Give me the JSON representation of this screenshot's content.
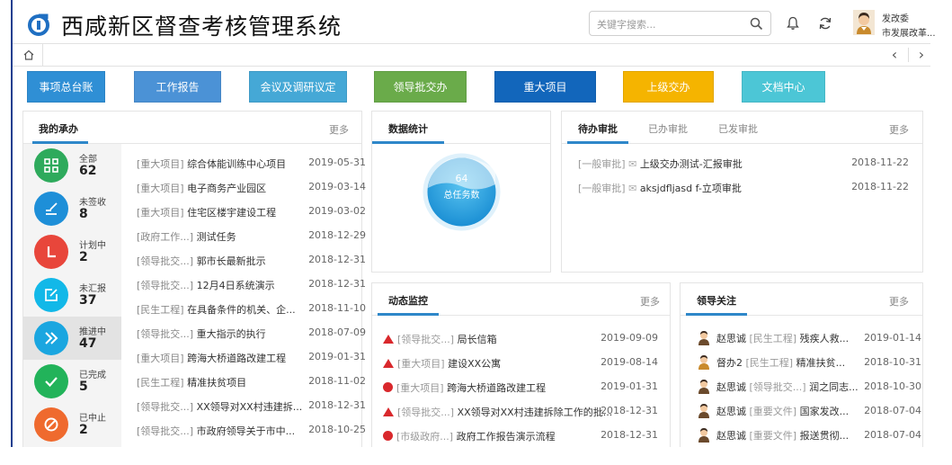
{
  "app": {
    "title": "西咸新区督查考核管理系统"
  },
  "header": {
    "search_placeholder": "关键字搜索...",
    "user": {
      "name": "发改委",
      "dept": "市发展改革..."
    }
  },
  "modules": [
    {
      "label": "事项总台账",
      "color": "#2f8fd5"
    },
    {
      "label": "工作报告",
      "color": "#4b92d6"
    },
    {
      "label": "会议及调研议定",
      "color": "#45a8d6"
    },
    {
      "label": "领导批交办",
      "color": "#6aab4a"
    },
    {
      "label": "重大项目",
      "color": "#1266bb"
    },
    {
      "label": "上级交办",
      "color": "#f5b400"
    },
    {
      "label": "文档中心",
      "color": "#4cc6d6"
    }
  ],
  "my_tasks": {
    "title": "我的承办",
    "more": "更多",
    "stats": [
      {
        "label": "全部",
        "count": "62",
        "color": "#2eaa5c",
        "icon": "grid-icon"
      },
      {
        "label": "未签收",
        "count": "8",
        "color": "#1e8fd8",
        "icon": "sign-icon"
      },
      {
        "label": "计划中",
        "count": "2",
        "color": "#e8463b",
        "icon": "clock-icon"
      },
      {
        "label": "未汇报",
        "count": "37",
        "color": "#12b8e8",
        "icon": "edit-icon"
      },
      {
        "label": "推进中",
        "count": "47",
        "color": "#1aa6e0",
        "icon": "forward-icon"
      },
      {
        "label": "已完成",
        "count": "5",
        "color": "#22b35a",
        "icon": "check-icon"
      },
      {
        "label": "已中止",
        "count": "2",
        "color": "#ef6a2e",
        "icon": "stop-icon"
      }
    ],
    "rows": [
      {
        "cat": "[重大项目]",
        "title": "综合体能训练中心项目",
        "date": "2019-05-31"
      },
      {
        "cat": "[重大项目]",
        "title": "电子商务产业园区",
        "date": "2019-03-14"
      },
      {
        "cat": "[重大项目]",
        "title": "住宅区楼宇建设工程",
        "date": "2019-03-02"
      },
      {
        "cat": "[政府工作...]",
        "title": "测试任务",
        "date": "2018-12-29"
      },
      {
        "cat": "[领导批交...]",
        "title": "郭市长最新批示",
        "date": "2018-12-31"
      },
      {
        "cat": "[领导批交...]",
        "title": "12月4日系统演示",
        "date": "2018-12-31"
      },
      {
        "cat": "[民生工程]",
        "title": "在具备条件的机关、企...",
        "date": "2018-11-10"
      },
      {
        "cat": "[领导批交...]",
        "title": "重大指示的执行",
        "date": "2018-07-09"
      },
      {
        "cat": "[重大项目]",
        "title": "跨海大桥道路改建工程",
        "date": "2019-01-31"
      },
      {
        "cat": "[民生工程]",
        "title": "精准扶贫项目",
        "date": "2018-11-02"
      },
      {
        "cat": "[领导批交...]",
        "title": "XX领导对XX村违建拆...",
        "date": "2018-12-31"
      },
      {
        "cat": "[领导批交...]",
        "title": "市政府领导关于市中...",
        "date": "2018-10-25"
      }
    ]
  },
  "statistics": {
    "title": "数据统计",
    "total": "64",
    "total_label": "总任务数"
  },
  "approvals": {
    "tabs": [
      "待办审批",
      "已办审批",
      "已发审批"
    ],
    "more": "更多",
    "rows": [
      {
        "cat": "[一般审批]",
        "title": "上级交办测试-汇报审批",
        "date": "2018-11-22"
      },
      {
        "cat": "[一般审批]",
        "title": "aksjdfljasd f-立项审批",
        "date": "2018-11-22"
      }
    ]
  },
  "dynamics": {
    "title": "动态监控",
    "more": "更多",
    "rows": [
      {
        "marker": "triangle",
        "cat": "[领导批交...]",
        "title": "局长信箱",
        "date": "2019-09-09"
      },
      {
        "marker": "triangle",
        "cat": "[重大项目]",
        "title": "建设XX公寓",
        "date": "2019-08-14"
      },
      {
        "marker": "dot",
        "cat": "[重大项目]",
        "title": "跨海大桥道路改建工程",
        "date": "2019-01-31"
      },
      {
        "marker": "triangle",
        "cat": "[领导批交...]",
        "title": "XX领导对XX村违建拆除工作的批...",
        "date": "2018-12-31"
      },
      {
        "marker": "dot",
        "cat": "[市级政府...]",
        "title": "政府工作报告演示流程",
        "date": "2018-12-31"
      }
    ]
  },
  "leader_focus": {
    "title": "领导关注",
    "more": "更多",
    "rows": [
      {
        "who": "赵思诚",
        "cat": "[民生工程]",
        "title": "残疾人救...",
        "date": "2019-01-14"
      },
      {
        "who": "督办2",
        "cat": "[民生工程]",
        "title": "精准扶贫...",
        "date": "2018-10-31"
      },
      {
        "who": "赵思诚",
        "cat": "[领导批交...]",
        "title": "润之同志...",
        "date": "2018-10-30"
      },
      {
        "who": "赵思诚",
        "cat": "[重要文件]",
        "title": "国家发改...",
        "date": "2018-07-04"
      },
      {
        "who": "赵思诚",
        "cat": "[重要文件]",
        "title": "报送贯彻...",
        "date": "2018-07-04"
      }
    ]
  }
}
